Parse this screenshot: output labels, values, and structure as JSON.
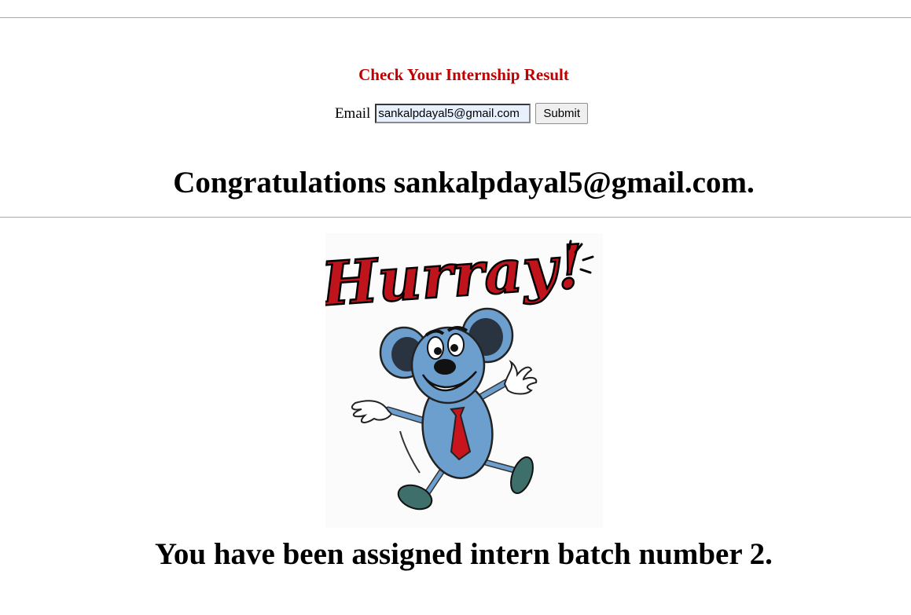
{
  "form": {
    "title": "Check Your Internship Result",
    "email_label": "Email",
    "email_value": "sankalpdayal5@gmail.com",
    "submit_label": "Submit"
  },
  "result": {
    "congrats_text": "Congratulations sankalpdayal5@gmail.com.",
    "image": {
      "banner_text": "Hurray!",
      "subject": "cartoon-mouse-jumping-icon"
    },
    "batch_text": "You have been assigned intern batch number 2."
  },
  "colors": {
    "title": "#c00000",
    "banner_red": "#c0141c",
    "mouse_blue": "#6c9fcd",
    "tie_red": "#c8141c"
  }
}
